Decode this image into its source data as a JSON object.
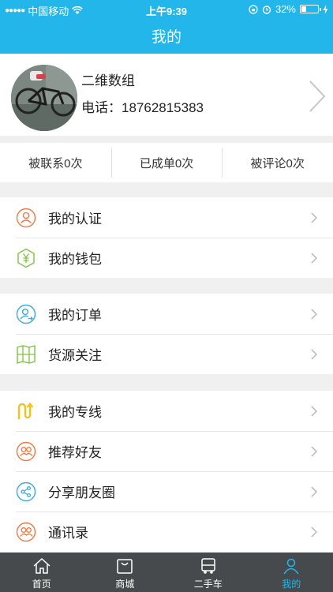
{
  "status_bar": {
    "carrier": "中国移动",
    "time": "上午9:39",
    "battery": "32%",
    "battery_level": 0.32
  },
  "nav": {
    "title": "我的"
  },
  "profile": {
    "name": "二维数组",
    "phone": "电话：18762815383"
  },
  "stats": [
    {
      "label": "被联系0次"
    },
    {
      "label": "已成单0次"
    },
    {
      "label": "被评论0次"
    }
  ],
  "groups": [
    {
      "items": [
        {
          "label": "我的认证",
          "icon": "certification-icon",
          "color": "#ef7a44"
        },
        {
          "label": "我的钱包",
          "icon": "wallet-icon",
          "color": "#7fc241"
        }
      ]
    },
    {
      "items": [
        {
          "label": "我的订单",
          "icon": "order-icon",
          "color": "#3ea8e0"
        },
        {
          "label": "货源关注",
          "icon": "map-icon",
          "color": "#7fc241"
        }
      ]
    },
    {
      "items": [
        {
          "label": "我的专线",
          "icon": "route-icon",
          "color": "#f2c21b"
        },
        {
          "label": "推荐好友",
          "icon": "friends-icon",
          "color": "#ef7a44"
        },
        {
          "label": "分享朋友圈",
          "icon": "share-icon",
          "color": "#3ea8e0"
        },
        {
          "label": "通讯录",
          "icon": "contacts-icon",
          "color": "#ef7a44"
        }
      ]
    }
  ],
  "tabbar": {
    "tabs": [
      {
        "label": "首页",
        "icon": "home-icon"
      },
      {
        "label": "商城",
        "icon": "shop-icon"
      },
      {
        "label": "二手车",
        "icon": "truck-icon"
      },
      {
        "label": "我的",
        "icon": "user-icon",
        "active": true
      }
    ]
  },
  "colors": {
    "accent": "#22b6ea",
    "tabbar_bg": "#474a4d",
    "page_bg": "#f0f0f0"
  }
}
